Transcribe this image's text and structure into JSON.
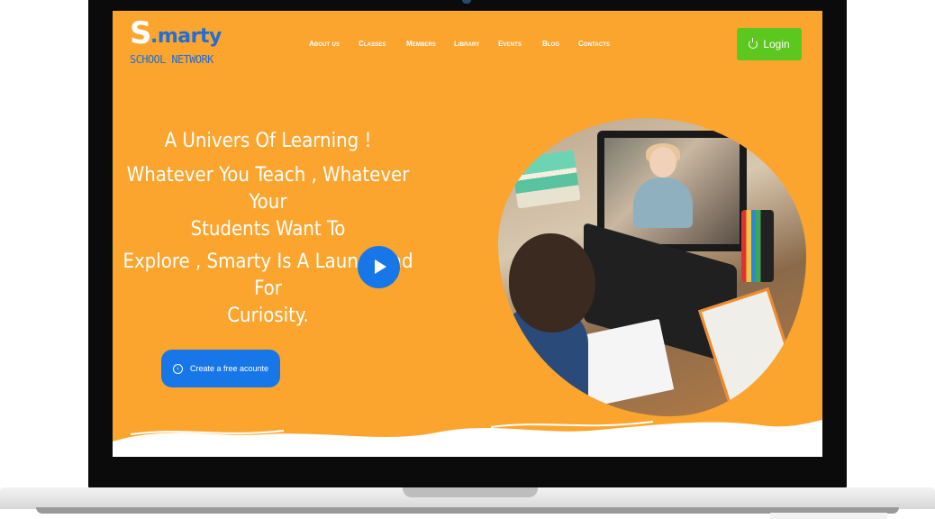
{
  "brand": {
    "logo_initial": "S",
    "logo_rest": ".marty",
    "logo_subtitle": "SCHOOL NETWORK",
    "primary_color": "#1877E8",
    "accent_color": "#FBA52E",
    "login_color": "#5CC71F"
  },
  "nav": {
    "items": [
      "About us",
      "Classes",
      "Members",
      "Library",
      "Events",
      "Blog",
      "Contacts"
    ]
  },
  "login": {
    "label": "Login",
    "icon": "power-icon"
  },
  "hero": {
    "line1": "A Univers Of Learning !",
    "line2a": "Whatever You Teach , Whatever Your",
    "line2b": "Students Want To",
    "line3a": "Explore , Smarty Is A Launchpad For",
    "line3b": "Curiosity.",
    "cta_label": "Create a free acounte",
    "cta_icon": "arrow-right-circle-icon"
  },
  "media": {
    "play_icon": "play-icon"
  }
}
